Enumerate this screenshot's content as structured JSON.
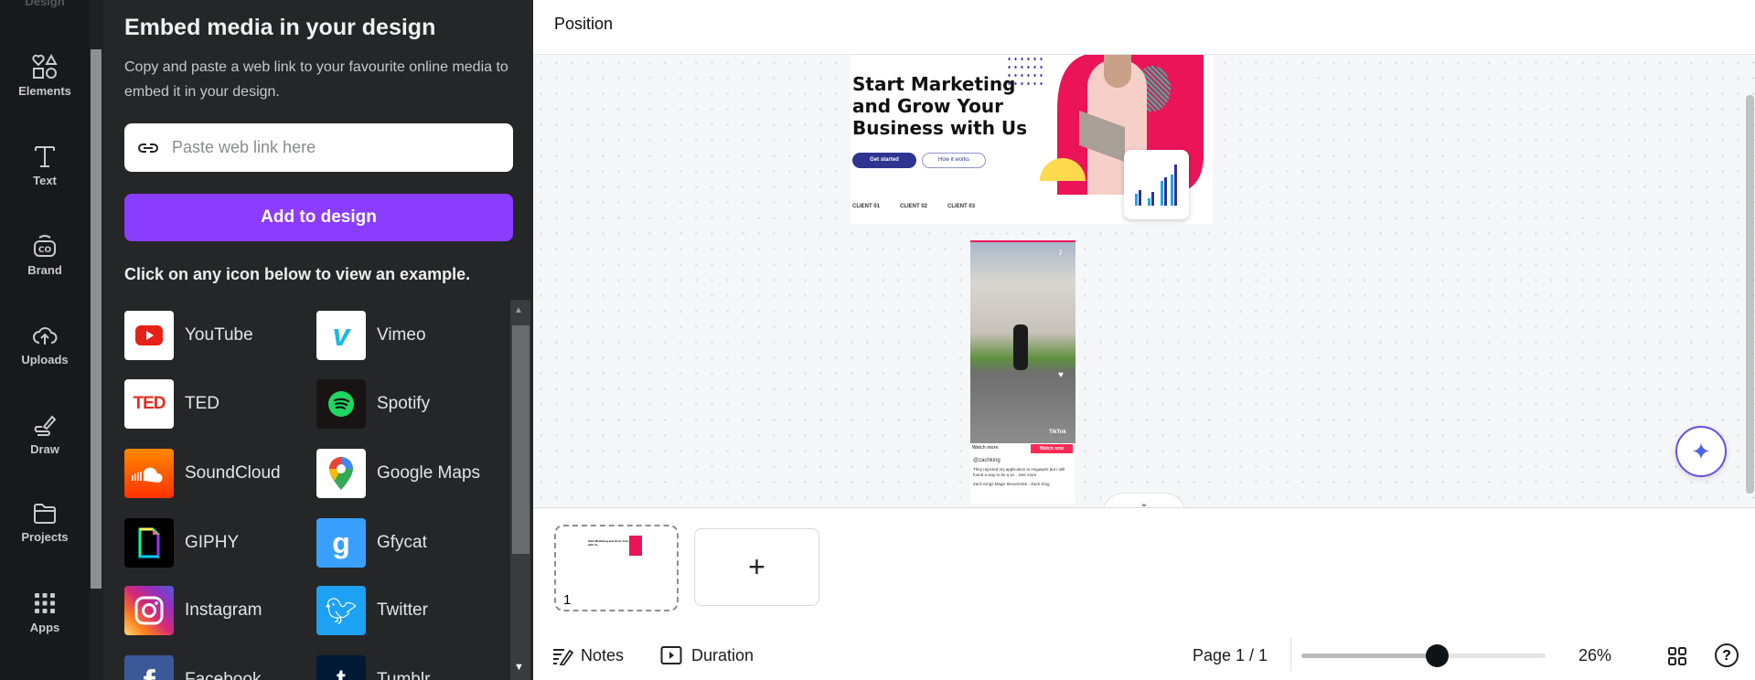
{
  "nav": {
    "items": [
      {
        "label": "Design",
        "icon": "design-icon"
      },
      {
        "label": "Elements",
        "icon": "elements-icon"
      },
      {
        "label": "Text",
        "icon": "text-icon"
      },
      {
        "label": "Brand",
        "icon": "brand-icon"
      },
      {
        "label": "Uploads",
        "icon": "upload-cloud-icon"
      },
      {
        "label": "Draw",
        "icon": "draw-icon"
      },
      {
        "label": "Projects",
        "icon": "folder-icon"
      },
      {
        "label": "Apps",
        "icon": "apps-grid-icon"
      }
    ]
  },
  "panel": {
    "title": "Embed media in your design",
    "description": "Copy and paste a web link to your favourite online media to embed it in your design.",
    "input_placeholder": "Paste web link here",
    "input_value": "",
    "add_button": "Add to design",
    "hint": "Click on any icon below to view an example.",
    "media": [
      {
        "label": "YouTube",
        "color": "#e62117"
      },
      {
        "label": "Vimeo",
        "color": "#1ab7ea"
      },
      {
        "label": "TED",
        "color": "#e62b1e"
      },
      {
        "label": "Spotify",
        "color": "#1ed760"
      },
      {
        "label": "SoundCloud",
        "color": "#ff5500"
      },
      {
        "label": "Google Maps",
        "color": "#34a853"
      },
      {
        "label": "GIPHY",
        "color": "#000000"
      },
      {
        "label": "Gfycat",
        "color": "#3aa0ff"
      },
      {
        "label": "Instagram",
        "color": "#d62976"
      },
      {
        "label": "Twitter",
        "color": "#1da1f2"
      },
      {
        "label": "Facebook",
        "color": "#3b5998"
      },
      {
        "label": "Tumblr",
        "color": "#001935"
      }
    ]
  },
  "header": {
    "title": "Position"
  },
  "design": {
    "headline": "Start Marketing and Grow Your Business with Us",
    "primary_button": "Get started",
    "secondary_button": "How it works",
    "clients": [
      "CLIENT 01",
      "CLIENT 02",
      "CLIENT 03"
    ],
    "accent": "#ec1459"
  },
  "tiktok": {
    "watch_more": "Watch more",
    "watch_now": "Watch now",
    "username": "@zachking",
    "caption": "They rejected my application to Hogwarts but I still found a way to be a wi ...See more",
    "sound": "Zach Kings Magic Broomstick - Zach King",
    "brand": "TikTok"
  },
  "pages": {
    "thumbnail_number": "1",
    "add_page": "+"
  },
  "footer": {
    "notes": "Notes",
    "duration": "Duration",
    "page_indicator": "Page 1 / 1",
    "zoom_value": 26,
    "zoom_label": "26%"
  }
}
